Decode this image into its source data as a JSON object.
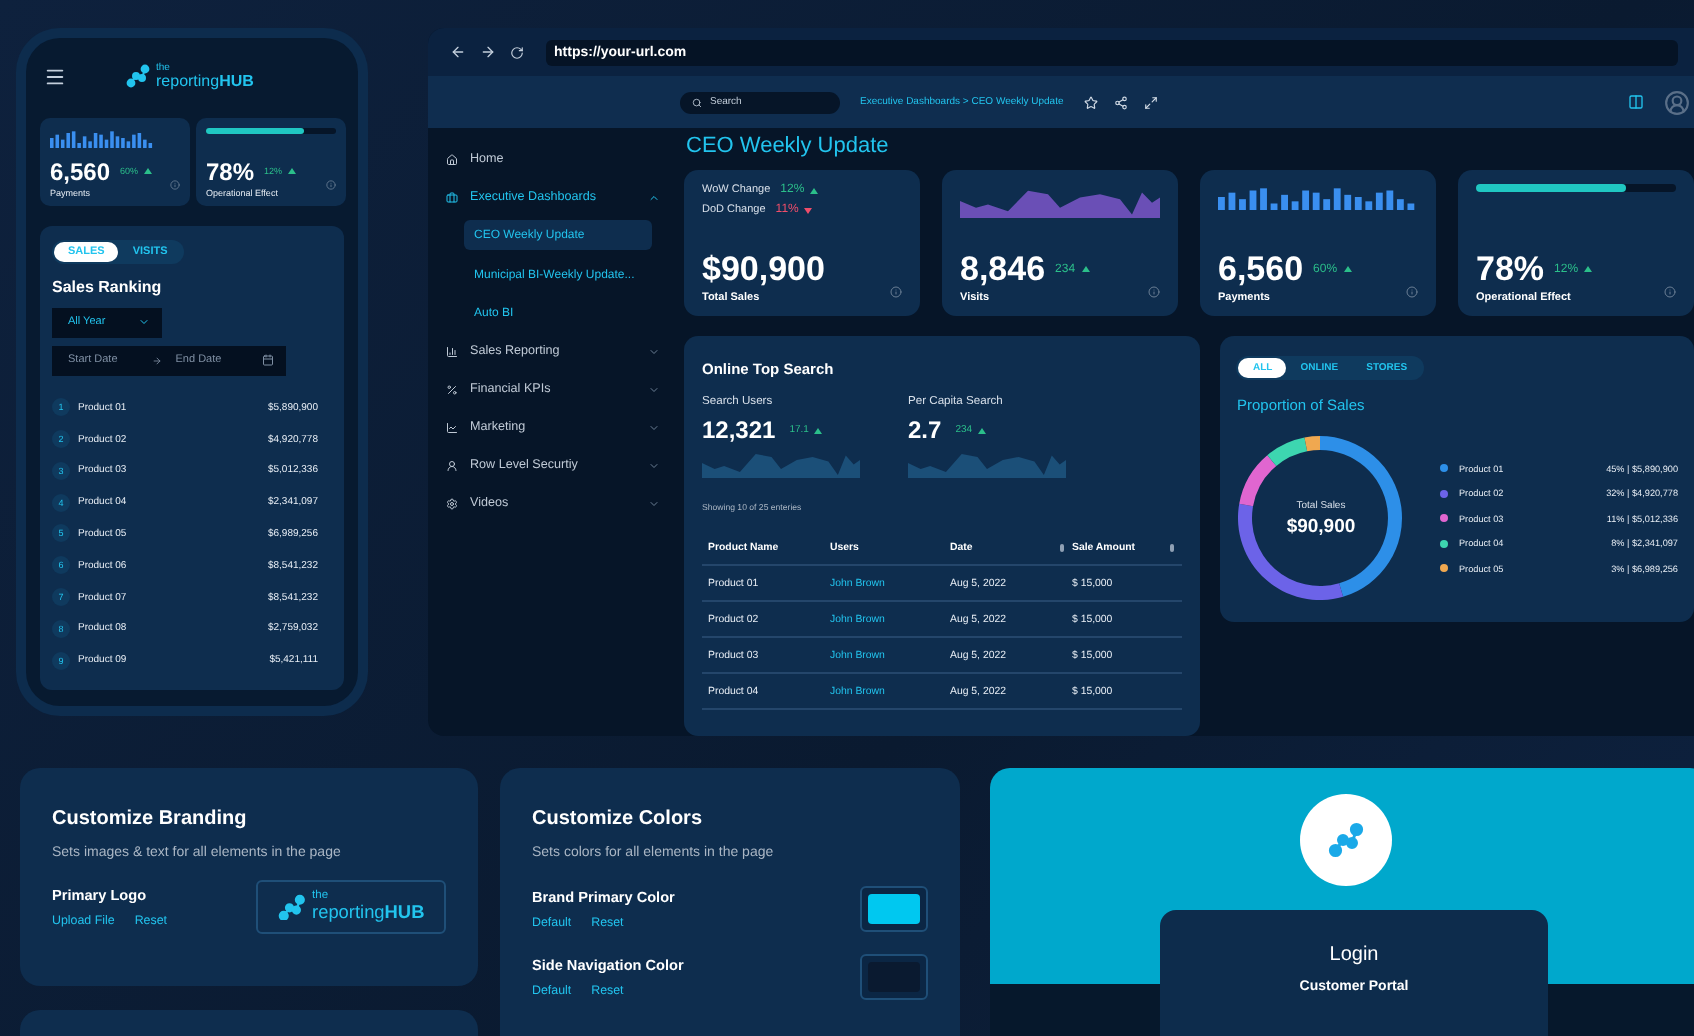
{
  "phone": {
    "logo": {
      "small": "the",
      "name": "reporting**HUB**"
    },
    "kpis": [
      {
        "kind": "bars",
        "value": "6,560",
        "change": "60%",
        "rising": true,
        "label": "Payments"
      },
      {
        "kind": "progress",
        "level": 0.75,
        "value": "78%",
        "change": "12%",
        "rising": true,
        "label": "Operational Effect"
      }
    ],
    "tabs": [
      {
        "label": "SALES",
        "selected": true
      },
      {
        "label": "VISITS",
        "selected": false
      }
    ],
    "title": "Sales Ranking",
    "dropdown": {
      "value": "All Year"
    },
    "date_range": {
      "start_placeholder": "Start Date",
      "end_placeholder": "End Date"
    },
    "rows": [
      {
        "rank": "1",
        "name": "Product 01",
        "amount": "$5,890,900"
      },
      {
        "rank": "2",
        "name": "Product 02",
        "amount": "$4,920,778"
      },
      {
        "rank": "3",
        "name": "Product 03",
        "amount": "$5,012,336"
      },
      {
        "rank": "4",
        "name": "Product 04",
        "amount": "$2,341,097"
      },
      {
        "rank": "5",
        "name": "Product 05",
        "amount": "$6,989,256"
      },
      {
        "rank": "6",
        "name": "Product 06",
        "amount": "$8,541,232"
      },
      {
        "rank": "7",
        "name": "Product 07",
        "amount": "$8,541,232"
      },
      {
        "rank": "8",
        "name": "Product 08",
        "amount": "$2,759,032"
      },
      {
        "rank": "9",
        "name": "Product 09",
        "amount": "$5,421,111"
      }
    ]
  },
  "browser": {
    "url": "https://your-url.com",
    "search": {
      "placeholder": "Search"
    },
    "breadcrumb": "Executive Dashboards > CEO Weekly Update",
    "sidebar": [
      {
        "kind": "link",
        "label": "Home"
      },
      {
        "kind": "group",
        "label": "Executive Dashboards",
        "expanded": true,
        "children": [
          {
            "label": "CEO Weekly Update",
            "selected": true
          },
          {
            "label": "Municipal BI-Weekly Update...",
            "selected": false
          },
          {
            "label": "Auto BI",
            "selected": false
          }
        ]
      },
      {
        "kind": "group",
        "label": "Sales Reporting",
        "expanded": false
      },
      {
        "kind": "group",
        "label": "Financial KPIs",
        "expanded": false
      },
      {
        "kind": "group",
        "label": "Marketing",
        "expanded": false
      },
      {
        "kind": "group",
        "label": "Row Level Securtiy",
        "expanded": false
      },
      {
        "kind": "group",
        "label": "Videos",
        "expanded": false
      }
    ],
    "page_title": "CEO Weekly Update",
    "kpis": [
      {
        "kind": "changes",
        "changes": [
          {
            "label": "WoW Change",
            "value": "12%",
            "rising": true
          },
          {
            "label": "DoD Change",
            "value": "11%",
            "rising": false
          }
        ],
        "value": "$90,900",
        "label": "Total Sales"
      },
      {
        "kind": "area",
        "value": "8,846",
        "change": "234",
        "rising": true,
        "label": "Visits"
      },
      {
        "kind": "bars",
        "value": "6,560",
        "change": "60%",
        "rising": true,
        "label": "Payments"
      },
      {
        "kind": "progress",
        "level": 0.75,
        "value": "78%",
        "change": "12%",
        "rising": true,
        "label": "Operational Effect"
      }
    ],
    "top_search": {
      "title": "Online Top Search",
      "metrics": [
        {
          "label": "Search Users",
          "value": "12,321",
          "change": "17.1",
          "rising": true
        },
        {
          "label": "Per Capita Search",
          "value": "2.7",
          "change": "234",
          "rising": true
        }
      ],
      "info": "Showing 10 of 25 enteries",
      "columns": [
        {
          "label": "Product Name",
          "sortable": false
        },
        {
          "label": "Users",
          "sortable": false
        },
        {
          "label": "Date",
          "sortable": true
        },
        {
          "label": "Sale Amount",
          "sortable": true
        }
      ],
      "rows": [
        [
          "Product 01",
          "John Brown",
          "Aug 5, 2022",
          "$ 15,000"
        ],
        [
          "Product 02",
          "John Brown",
          "Aug 5, 2022",
          "$ 15,000"
        ],
        [
          "Product 03",
          "John Brown",
          "Aug 5, 2022",
          "$ 15,000"
        ],
        [
          "Product 04",
          "John Brown",
          "Aug 5, 2022",
          "$ 15,000"
        ]
      ]
    },
    "proportion": {
      "tabs": [
        {
          "label": "ALL",
          "selected": true
        },
        {
          "label": "ONLINE",
          "selected": false
        },
        {
          "label": "STORES",
          "selected": false
        }
      ],
      "title": "Proportion of Sales",
      "center_label": "Total Sales",
      "center_value": "$90,900",
      "chart_data": {
        "type": "donut",
        "categories": [
          "Product 01",
          "Product 02",
          "Product 03",
          "Product 04",
          "Product 05"
        ],
        "values": [
          45,
          32,
          11,
          8,
          3
        ]
      },
      "legend": [
        {
          "reading": "45% | $5,890,900",
          "color": "#2d8fe8"
        },
        {
          "reading": "32% | $4,920,778",
          "color": "#6c63e8"
        },
        {
          "reading": "11% | $5,012,336",
          "color": "#e066d0"
        },
        {
          "reading": "8% | $2,341,097",
          "color": "#3dd6b0"
        },
        {
          "reading": "3% | $6,989,256",
          "color": "#f0a850"
        }
      ]
    }
  },
  "branding": {
    "title": "Customize Branding",
    "subtitle": "Sets images & text for all elements in the page",
    "field": "Primary Logo",
    "links": [
      "Upload File",
      "Reset"
    ],
    "logo": {
      "small": "the",
      "name": "reporting**HUB**"
    }
  },
  "colors": {
    "title": "Customize Colors",
    "subtitle": "Sets colors for all elements in the page",
    "rows": [
      {
        "label": "Brand Primary Color",
        "links": [
          "Default",
          "Reset"
        ],
        "color": "#00c8f0"
      },
      {
        "label": "Side Navigation Color",
        "links": [
          "Default",
          "Reset"
        ],
        "color": "#0a1a30"
      }
    ]
  },
  "login": {
    "title": "Login",
    "subtitle": "Customer Portal"
  }
}
